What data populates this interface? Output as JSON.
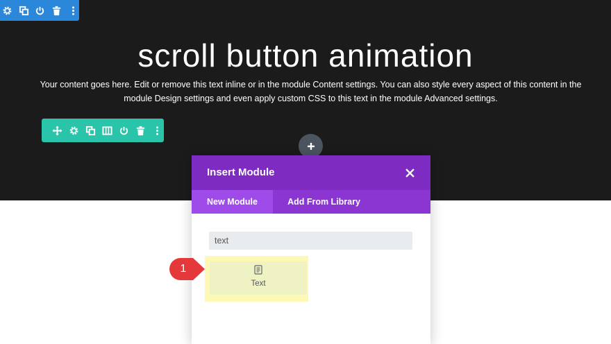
{
  "section_toolbar": {
    "color": "#2b87da",
    "icons": [
      "gear-icon",
      "duplicate-icon",
      "power-icon",
      "trash-icon",
      "more-vertical-icon"
    ]
  },
  "row_toolbar": {
    "color": "#29c4a9",
    "icons": [
      "move-icon",
      "gear-icon",
      "duplicate-icon",
      "columns-icon",
      "power-icon",
      "trash-icon",
      "more-vertical-icon"
    ]
  },
  "hero": {
    "title": "scroll button animation",
    "body": "Your content goes here. Edit or remove this text inline or in the module Content settings. You can also style every aspect of this content in the module Design settings and even apply custom CSS to this text in the module Advanced settings.",
    "background": "#1b1b1b"
  },
  "add_button": {
    "icon": "plus-icon",
    "color": "#4a5560"
  },
  "modal": {
    "title": "Insert Module",
    "header_color": "#7e2bc2",
    "tabs": [
      {
        "label": "New Module",
        "active": true
      },
      {
        "label": "Add From Library",
        "active": false
      }
    ],
    "search": {
      "value": "text",
      "placeholder": ""
    },
    "results": [
      {
        "label": "Text",
        "icon": "text-module-icon"
      }
    ]
  },
  "annotation": {
    "step": "1",
    "color": "#e5383b"
  }
}
